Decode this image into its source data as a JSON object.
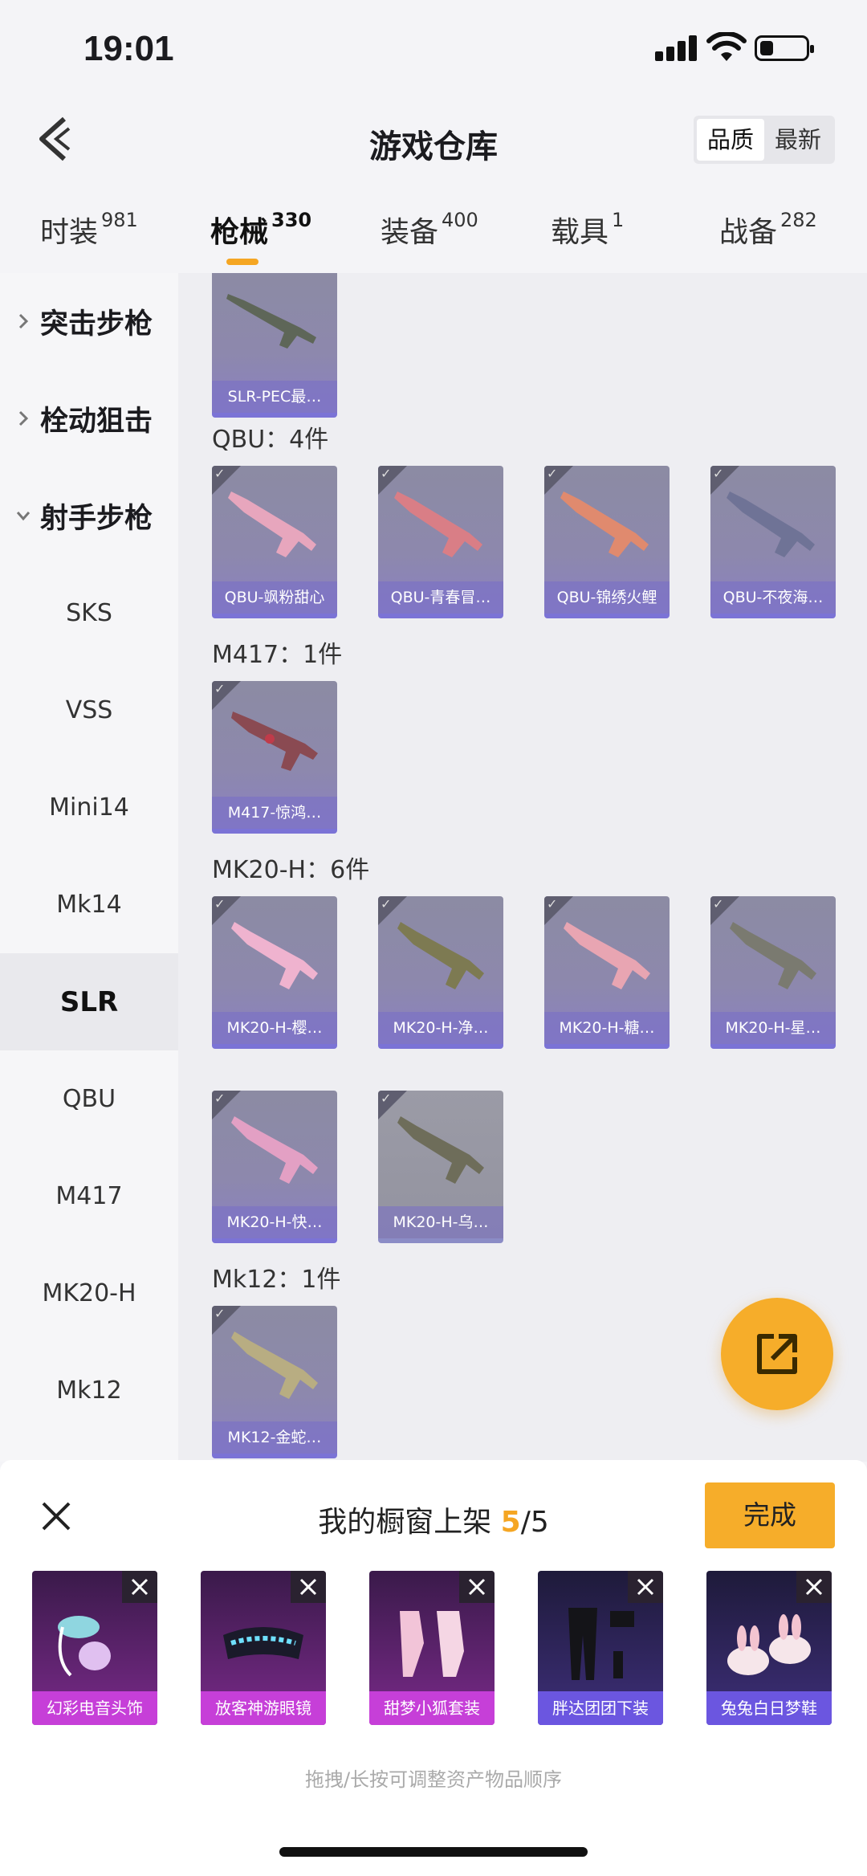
{
  "status_bar": {
    "time": "19:01"
  },
  "header": {
    "title": "游戏仓库",
    "sort_options": [
      "品质",
      "最新"
    ],
    "sort_selected": "品质"
  },
  "tabs": [
    {
      "label": "时装",
      "count": "981"
    },
    {
      "label": "枪械",
      "count": "330",
      "active": true
    },
    {
      "label": "装备",
      "count": "400"
    },
    {
      "label": "载具",
      "count": "1"
    },
    {
      "label": "战备",
      "count": "282"
    }
  ],
  "sidebar": {
    "groups": [
      {
        "label": "突击步枪",
        "expanded": false
      },
      {
        "label": "栓动狙击",
        "expanded": false
      },
      {
        "label": "射手步枪",
        "expanded": true
      }
    ],
    "items": [
      "SKS",
      "VSS",
      "Mini14",
      "Mk14",
      "SLR",
      "QBU",
      "M417",
      "MK20-H",
      "Mk12"
    ],
    "selected": "SLR"
  },
  "content": {
    "slr_item": "SLR-PEC最…",
    "sections": [
      {
        "label": "QBU：4件",
        "items": [
          "QBU-飒粉甜心",
          "QBU-青春冒…",
          "QBU-锦绣火鲤",
          "QBU-不夜海…"
        ]
      },
      {
        "label": "M417：1件",
        "items": [
          "M417-惊鸿…"
        ]
      },
      {
        "label": "MK20-H：6件",
        "items": [
          "MK20-H-樱…",
          "MK20-H-净…",
          "MK20-H-糖…",
          "MK20-H-星…",
          "MK20-H-快…",
          "MK20-H-乌…"
        ]
      },
      {
        "label": "Mk12：1件",
        "items": [
          "MK12-金蛇…"
        ]
      }
    ]
  },
  "panel": {
    "title_prefix": "我的橱窗上架 ",
    "count_current": "5",
    "count_total": "/5",
    "done_label": "完成",
    "items": [
      "幻彩电音头饰",
      "放客神游眼镜",
      "甜梦小狐套装",
      "胖达团团下装",
      "兔兔白日梦鞋"
    ],
    "hint": "拖拽/长按可调整资产物品顺序"
  },
  "colors": {
    "accent": "#f6ad2a",
    "card_purple": "#8a80c2",
    "shelf_magenta": "#c63fd8"
  }
}
